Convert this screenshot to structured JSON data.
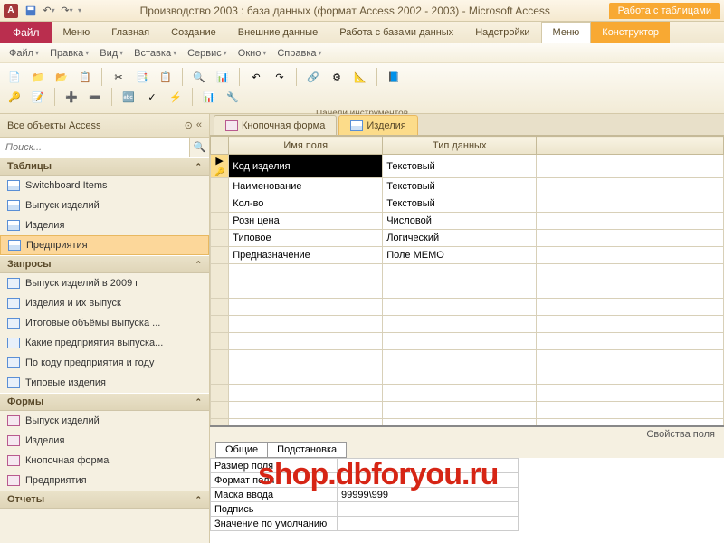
{
  "title": "Производство 2003 : база данных (формат Access 2002 - 2003)  -  Microsoft Access",
  "context_tab": "Работа с таблицами",
  "file_tab": "Файл",
  "menu": [
    "Меню",
    "Главная",
    "Создание",
    "Внешние данные",
    "Работа с базами данных",
    "Надстройки",
    "Меню",
    "Конструктор"
  ],
  "toolbar2": [
    "Файл",
    "Правка",
    "Вид",
    "Вставка",
    "Сервис",
    "Окно",
    "Справка"
  ],
  "ribbon_label": "Панели инструментов",
  "nav": {
    "title": "Все объекты Access",
    "search_ph": "Поиск...",
    "groups": [
      {
        "name": "Таблицы",
        "items": [
          "Switchboard Items",
          "Выпуск изделий",
          "Изделия",
          "Предприятия"
        ],
        "icon": "table",
        "sel": 3
      },
      {
        "name": "Запросы",
        "items": [
          "Выпуск изделий в 2009 г",
          "Изделия и их выпуск",
          "Итоговые объёмы выпуска ...",
          "Какие предприятия выпуска...",
          "По коду предприятия и году",
          "Типовые изделия"
        ],
        "icon": "query"
      },
      {
        "name": "Формы",
        "items": [
          "Выпуск изделий",
          "Изделия",
          "Кнопочная форма",
          "Предприятия"
        ],
        "icon": "form"
      },
      {
        "name": "Отчеты",
        "items": []
      }
    ]
  },
  "tabs": [
    {
      "label": "Кнопочная форма",
      "active": false
    },
    {
      "label": "Изделия",
      "active": true
    }
  ],
  "grid": {
    "cols": [
      "Имя поля",
      "Тип данных"
    ],
    "rows": [
      {
        "pk": true,
        "name": "Код изделия",
        "type": "Текстовый",
        "cur": true
      },
      {
        "pk": false,
        "name": "Наименование",
        "type": "Текстовый"
      },
      {
        "pk": false,
        "name": "Кол-во",
        "type": "Текстовый"
      },
      {
        "pk": false,
        "name": "Розн цена",
        "type": "Числовой"
      },
      {
        "pk": false,
        "name": "Типовое",
        "type": "Логический"
      },
      {
        "pk": false,
        "name": "Предназначение",
        "type": "Поле МЕМО"
      }
    ]
  },
  "props": {
    "title": "Свойства поля",
    "tabs": [
      "Общие",
      "Подстановка"
    ],
    "rows": [
      {
        "l": "Размер поля",
        "v": ""
      },
      {
        "l": "Формат поля",
        "v": ""
      },
      {
        "l": "Маска ввода",
        "v": "99999\\999"
      },
      {
        "l": "Подпись",
        "v": ""
      },
      {
        "l": "Значение по умолчанию",
        "v": ""
      }
    ]
  },
  "watermark": "shop.dbforyou.ru"
}
